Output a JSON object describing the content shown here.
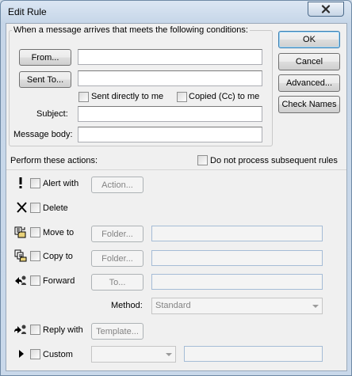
{
  "window": {
    "title": "Edit Rule"
  },
  "conditions": {
    "group_label": "When a message arrives that meets the following conditions:",
    "from_button": "From...",
    "from_value": "",
    "sent_to_button": "Sent To...",
    "sent_to_value": "",
    "sent_directly_label": "Sent directly to me",
    "copied_label": "Copied (Cc) to me",
    "subject_label": "Subject:",
    "subject_value": "",
    "message_body_label": "Message body:",
    "message_body_value": ""
  },
  "side_buttons": {
    "ok": "OK",
    "cancel": "Cancel",
    "advanced": "Advanced...",
    "check_names": "Check Names"
  },
  "actions": {
    "header": "Perform these actions:",
    "do_not_process_label": "Do not process subsequent rules",
    "alert_label": "Alert with",
    "alert_button": "Action...",
    "delete_label": "Delete",
    "move_label": "Move to",
    "move_button": "Folder...",
    "copy_label": "Copy to",
    "copy_button": "Folder...",
    "forward_label": "Forward",
    "forward_button": "To...",
    "method_label": "Method:",
    "method_value": "Standard",
    "reply_label": "Reply with",
    "reply_button": "Template...",
    "custom_label": "Custom",
    "custom_value": ""
  },
  "icons": {
    "alert": "exclamation-icon",
    "delete": "delete-x-icon",
    "move": "move-to-folder-icon",
    "copy": "copy-to-folder-icon",
    "forward": "forward-icon",
    "reply": "reply-icon",
    "custom": "play-arrow-icon"
  }
}
